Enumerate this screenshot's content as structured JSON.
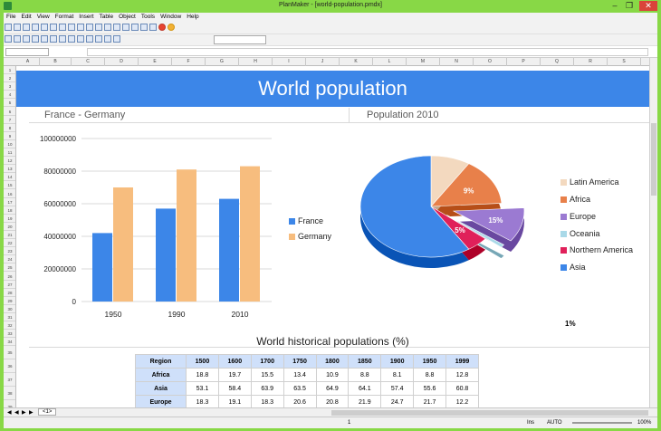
{
  "window": {
    "title": "PlanMaker - [world-population.pmdx]",
    "min": "–",
    "max": "❐",
    "close": "✕"
  },
  "menu": [
    "File",
    "Edit",
    "View",
    "Format",
    "Insert",
    "Table",
    "Object",
    "Tools",
    "Window",
    "Help"
  ],
  "formula": {
    "cellref": ""
  },
  "columns": [
    "A",
    "B",
    "C",
    "D",
    "E",
    "F",
    "G",
    "H",
    "I",
    "J",
    "K",
    "L",
    "M",
    "N",
    "O",
    "P",
    "Q",
    "R",
    "S"
  ],
  "rows": [
    "1",
    "2",
    "3",
    "4",
    "5",
    "6",
    "7",
    "8",
    "9",
    "10",
    "11",
    "12",
    "13",
    "14",
    "15",
    "16",
    "17",
    "18",
    "19",
    "20",
    "21",
    "22",
    "23",
    "24",
    "25",
    "26",
    "27",
    "28",
    "29",
    "30",
    "31",
    "32",
    "33",
    "34",
    "35",
    "36",
    "37",
    "38",
    "39"
  ],
  "banner": "World population",
  "left_heading": "France - Germany",
  "right_heading": "Population 2010",
  "table_title": "World historical populations (%)",
  "pie_note": "1%",
  "colors": {
    "blue": "#3c86e8",
    "orange": "#f7bd7e",
    "accent": "#88d846"
  },
  "chart_data": [
    {
      "type": "bar",
      "title": "France - Germany",
      "categories": [
        "1950",
        "1990",
        "2010"
      ],
      "ylim": [
        0,
        100000000
      ],
      "yticks": [
        "100000000",
        "80000000",
        "60000000",
        "40000000",
        "20000000",
        "0"
      ],
      "grid": true,
      "legend_position": "right",
      "series": [
        {
          "name": "France",
          "color": "#3c86e8",
          "values": [
            42000000,
            57000000,
            63000000
          ]
        },
        {
          "name": "Germany",
          "color": "#f7bd7e",
          "values": [
            70000000,
            81000000,
            83000000
          ]
        }
      ]
    },
    {
      "type": "pie",
      "title": "Population 2010",
      "legend_position": "right",
      "slices": [
        {
          "name": "Latin America",
          "color": "#f3d9bf",
          "value": 9
        },
        {
          "name": "Africa",
          "color": "#e8804a",
          "value": 15,
          "label": "9%"
        },
        {
          "name": "Europe",
          "color": "#9b7ad2",
          "value": 11,
          "label": "15%"
        },
        {
          "name": "Oceania",
          "color": "#a9d9e8",
          "value": 1
        },
        {
          "name": "Northern America",
          "color": "#e0205a",
          "value": 5,
          "label": "5%"
        },
        {
          "name": "Asia",
          "color": "#3c86e8",
          "value": 59
        }
      ]
    }
  ],
  "pop_table": {
    "header": [
      "Region",
      "1500",
      "1600",
      "1700",
      "1750",
      "1800",
      "1850",
      "1900",
      "1950",
      "1999"
    ],
    "rows": [
      [
        "Africa",
        "18.8",
        "19.7",
        "15.5",
        "13.4",
        "10.9",
        "8.8",
        "8.1",
        "8.8",
        "12.8"
      ],
      [
        "Asia",
        "53.1",
        "58.4",
        "63.9",
        "63.5",
        "64.9",
        "64.1",
        "57.4",
        "55.6",
        "60.8"
      ],
      [
        "Europe",
        "18.3",
        "19.1",
        "18.3",
        "20.6",
        "20.8",
        "21.9",
        "24.7",
        "21.7",
        "12.2"
      ]
    ]
  },
  "status": {
    "cell": "1",
    "ins": "Ins",
    "auto": "AUTO",
    "zoom": "100%"
  },
  "tabs": {
    "sheet": "<1>"
  }
}
